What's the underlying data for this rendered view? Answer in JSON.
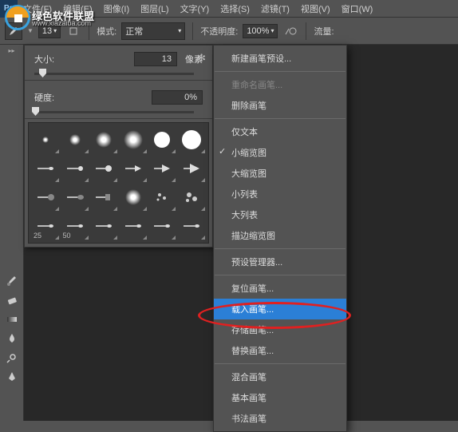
{
  "menubar": {
    "items": [
      "文件(F)",
      "编辑(E)",
      "图像(I)",
      "图层(L)",
      "文字(Y)",
      "选择(S)",
      "滤镜(T)",
      "视图(V)",
      "窗口(W)"
    ]
  },
  "optbar": {
    "size_value": "13",
    "mode_label": "模式:",
    "mode_value": "正常",
    "opacity_label": "不透明度:",
    "opacity_value": "100%",
    "flow_label": "流量:"
  },
  "brush_panel": {
    "size_label": "大小:",
    "size_value": "13",
    "size_unit": "像素",
    "hardness_label": "硬度:",
    "hardness_value": "0%",
    "grid_labels": [
      "25",
      "50"
    ]
  },
  "context_menu": {
    "items": [
      {
        "label": "新建画笔预设...",
        "enabled": true
      },
      {
        "sep": true
      },
      {
        "label": "重命名画笔...",
        "enabled": false
      },
      {
        "label": "删除画笔",
        "enabled": true
      },
      {
        "sep": true
      },
      {
        "label": "仅文本",
        "enabled": true
      },
      {
        "label": "小缩览图",
        "enabled": true,
        "checked": true
      },
      {
        "label": "大缩览图",
        "enabled": true
      },
      {
        "label": "小列表",
        "enabled": true
      },
      {
        "label": "大列表",
        "enabled": true
      },
      {
        "label": "描边缩览图",
        "enabled": true
      },
      {
        "sep": true
      },
      {
        "label": "预设管理器...",
        "enabled": true
      },
      {
        "sep": true
      },
      {
        "label": "复位画笔...",
        "enabled": true
      },
      {
        "label": "载入画笔...",
        "enabled": true,
        "highlighted": true
      },
      {
        "label": "存储画笔...",
        "enabled": true
      },
      {
        "label": "替换画笔...",
        "enabled": true
      },
      {
        "sep": true
      },
      {
        "label": "混合画笔",
        "enabled": true
      },
      {
        "label": "基本画笔",
        "enabled": true
      },
      {
        "label": "书法画笔",
        "enabled": true
      }
    ]
  },
  "watermark": {
    "text": "绿色软件联盟",
    "sub": "www.xiazaiba.com"
  }
}
